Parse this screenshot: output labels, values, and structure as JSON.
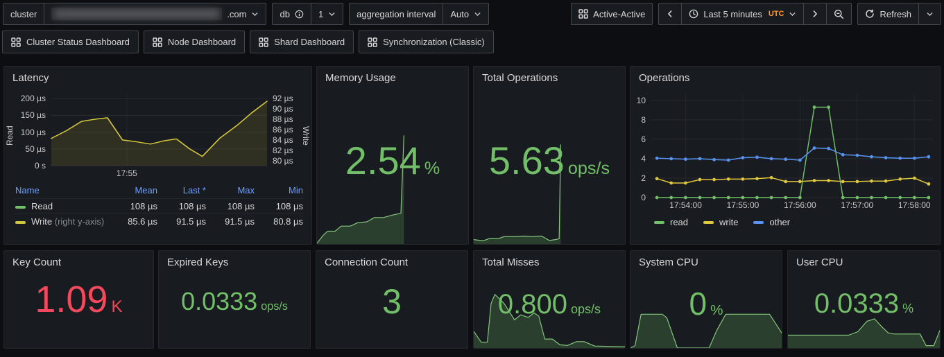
{
  "toolbar": {
    "cluster": {
      "label": "cluster",
      "value_suffix": ".com"
    },
    "db": {
      "label": "db",
      "value": "1"
    },
    "aggregation": {
      "label": "aggregation interval",
      "value": "Auto"
    },
    "active_active_label": "Active-Active",
    "time_range": {
      "label": "Last 5 minutes",
      "timezone": "UTC"
    },
    "refresh_label": "Refresh"
  },
  "nav": {
    "links": [
      {
        "label": "Cluster Status Dashboard"
      },
      {
        "label": "Node Dashboard"
      },
      {
        "label": "Shard Dashboard"
      },
      {
        "label": "Synchronization (Classic)"
      }
    ]
  },
  "colors": {
    "green": "#73BF69",
    "red": "#F2495C",
    "yellow": "#d4c63c",
    "blue": "#5794F2",
    "link_blue": "#6E9FFF",
    "utc_orange": "#FF9830"
  },
  "icons": {
    "apps_icon": "grid of four squares",
    "info_circle_icon": "i in circle",
    "clock_icon": "clock face",
    "zoom_out_icon": "magnifier with minus",
    "refresh_icon": "circular sync arrow",
    "chevron_down_icon": "v",
    "chevron_left_icon": "<",
    "chevron_right_icon": ">"
  },
  "panels": {
    "latency": {
      "title": "Latency",
      "legend": {
        "headers": [
          "Name",
          "Mean",
          "Last *",
          "Max",
          "Min"
        ],
        "rows": [
          {
            "name": "Read",
            "note": "",
            "color": "#73BF69",
            "mean": "108 µs",
            "last": "108 µs",
            "max": "108 µs",
            "min": "108 µs"
          },
          {
            "name": "Write",
            "note": "(right y-axis)",
            "color": "#d4c63c",
            "mean": "85.6 µs",
            "last": "91.5 µs",
            "max": "91.5 µs",
            "min": "80.8 µs"
          }
        ]
      }
    },
    "memory": {
      "title": "Memory Usage",
      "value": "2.54",
      "unit": "%"
    },
    "total_operations": {
      "title": "Total Operations",
      "value": "5.63",
      "unit": "ops/s"
    },
    "operations": {
      "title": "Operations",
      "legend": [
        {
          "label": "read",
          "color": "#73BF69"
        },
        {
          "label": "write",
          "color": "#e0c73e"
        },
        {
          "label": "other",
          "color": "#5794F2"
        }
      ]
    },
    "key_count": {
      "title": "Key Count",
      "value": "1.09",
      "unit": "K"
    },
    "expired_keys": {
      "title": "Expired Keys",
      "value": "0.0333",
      "unit": "ops/s"
    },
    "connection_count": {
      "title": "Connection Count",
      "value": "3",
      "unit": ""
    },
    "total_misses": {
      "title": "Total Misses",
      "value": "0.800",
      "unit": "ops/s"
    },
    "system_cpu": {
      "title": "System CPU",
      "value": "0",
      "unit": "%"
    },
    "user_cpu": {
      "title": "User CPU",
      "value": "0.0333",
      "unit": "%"
    }
  },
  "chart_data": [
    {
      "id": "latency",
      "type": "line",
      "vb": [
        270,
        104
      ],
      "axes": {
        "left": {
          "label": "Read",
          "ylim": [
            0,
            215
          ],
          "ticks": [
            {
              "v": 200,
              "label": "200 µs"
            },
            {
              "v": 150,
              "label": "150 µs"
            },
            {
              "v": 100,
              "label": "100 µs"
            },
            {
              "v": 50,
              "label": "50 µs"
            },
            {
              "v": 0,
              "label": "0 s"
            }
          ]
        },
        "right": {
          "label": "Write",
          "ylim": [
            79,
            93
          ],
          "ticks": [
            {
              "v": 92,
              "label": "92 µs"
            },
            {
              "v": 90,
              "label": "90 µs"
            },
            {
              "v": 88,
              "label": "88 µs"
            },
            {
              "v": 86,
              "label": "86 µs"
            },
            {
              "v": 84,
              "label": "84 µs"
            },
            {
              "v": 82,
              "label": "82 µs"
            },
            {
              "v": 80,
              "label": "80 µs"
            }
          ]
        }
      },
      "grid_y": [
        0,
        50,
        100,
        150,
        200
      ],
      "xticks": [
        {
          "frac": 0.35,
          "label": "17:55"
        }
      ],
      "series": [
        {
          "name": "Read",
          "axis": "left",
          "color": "#73BF69",
          "visible": false,
          "x": [
            0,
            1
          ],
          "values": [
            108,
            108
          ]
        },
        {
          "name": "Write",
          "axis": "right",
          "color": "#d4c63c",
          "fill": "rgba(212,198,60,0.12)",
          "width": 1.5,
          "x": [
            0,
            0.07,
            0.14,
            0.2,
            0.26,
            0.33,
            0.4,
            0.46,
            0.52,
            0.58,
            0.64,
            0.7,
            0.78,
            0.86,
            0.93,
            1.0
          ],
          "values": [
            84.3,
            85.8,
            87.6,
            88.0,
            88.3,
            84.0,
            83.6,
            83.2,
            83.8,
            84.2,
            82.3,
            80.8,
            84.3,
            86.8,
            89.3,
            91.5
          ]
        }
      ]
    },
    {
      "id": "operations",
      "type": "line",
      "vb": [
        415,
        150
      ],
      "axes": {
        "left": {
          "label": "",
          "ylim": [
            0,
            10.7
          ],
          "ticks": [
            {
              "v": 10,
              "label": "10"
            },
            {
              "v": 8,
              "label": "8"
            },
            {
              "v": 6,
              "label": "6"
            },
            {
              "v": 4,
              "label": "4"
            },
            {
              "v": 2,
              "label": "2"
            },
            {
              "v": 0,
              "label": "0"
            }
          ]
        }
      },
      "grid_y": [
        0,
        2,
        4,
        6,
        8,
        10
      ],
      "xticks": [
        {
          "frac": 0.122,
          "label": "17:54:00"
        },
        {
          "frac": 0.325,
          "label": "17:55:00"
        },
        {
          "frac": 0.528,
          "label": "17:56:00"
        },
        {
          "frac": 0.731,
          "label": "17:57:00"
        },
        {
          "frac": 0.934,
          "label": "17:58:00"
        }
      ],
      "series": [
        {
          "name": "read",
          "axis": "left",
          "color": "#73BF69",
          "points": true,
          "width": 1.5,
          "x": [
            0.02,
            0.0708,
            0.1216,
            0.1724,
            0.2232,
            0.274,
            0.3248,
            0.3756,
            0.4264,
            0.4772,
            0.528,
            0.5788,
            0.6296,
            0.6804,
            0.7312,
            0.782,
            0.8328,
            0.8836,
            0.9344,
            0.985
          ],
          "values": [
            0,
            0,
            0,
            0,
            0,
            0,
            0,
            0,
            0,
            0,
            0,
            9.3,
            9.3,
            0,
            0,
            0,
            0,
            0,
            0,
            0
          ]
        },
        {
          "name": "write",
          "axis": "left",
          "color": "#e0c73e",
          "points": true,
          "width": 1.5,
          "x": [
            0.02,
            0.0708,
            0.1216,
            0.1724,
            0.2232,
            0.274,
            0.3248,
            0.3756,
            0.4264,
            0.4772,
            0.528,
            0.5788,
            0.6296,
            0.6804,
            0.7312,
            0.782,
            0.8328,
            0.8836,
            0.9344,
            0.985
          ],
          "values": [
            1.95,
            1.5,
            1.5,
            1.85,
            1.85,
            1.9,
            1.9,
            1.95,
            2.05,
            1.65,
            1.65,
            1.75,
            1.75,
            1.65,
            1.65,
            1.7,
            1.7,
            1.9,
            2.0,
            1.4
          ]
        },
        {
          "name": "other",
          "axis": "left",
          "color": "#5794F2",
          "points": true,
          "width": 1.5,
          "x": [
            0.02,
            0.0708,
            0.1216,
            0.1724,
            0.2232,
            0.274,
            0.3248,
            0.3756,
            0.4264,
            0.4772,
            0.528,
            0.5788,
            0.6296,
            0.6804,
            0.7312,
            0.782,
            0.8328,
            0.8836,
            0.9344,
            0.985
          ],
          "values": [
            4.05,
            4.0,
            3.95,
            4.0,
            3.9,
            3.85,
            4.1,
            4.15,
            4.0,
            3.95,
            3.85,
            5.1,
            5.05,
            4.4,
            4.35,
            4.2,
            4.1,
            4.05,
            4.05,
            4.2
          ]
        }
      ]
    },
    {
      "id": "spark_memory",
      "type": "area",
      "vb": [
        220,
        160
      ],
      "ylim": [
        0,
        2.6
      ],
      "series": [
        {
          "color": "#86c77d",
          "width": 1.2,
          "fill": "rgba(115,191,105,0.22)",
          "x": [
            0,
            0.04,
            0.07,
            0.12,
            0.16,
            0.22,
            0.27,
            0.33,
            0.38,
            0.44,
            0.5,
            0.555,
            0.575
          ],
          "values": [
            0.02,
            0.2,
            0.3,
            0.3,
            0.42,
            0.42,
            0.5,
            0.52,
            0.62,
            0.62,
            0.68,
            0.72,
            2.54
          ]
        }
      ]
    },
    {
      "id": "spark_totalops",
      "type": "area",
      "vb": [
        220,
        150
      ],
      "ylim": [
        0,
        5.9
      ],
      "series": [
        {
          "color": "#86c77d",
          "width": 1.2,
          "fill": "rgba(115,191,105,0.22)",
          "x": [
            0,
            0.06,
            0.1,
            0.16,
            0.2,
            0.28,
            0.33,
            0.38,
            0.45,
            0.5,
            0.54,
            0.565,
            0.575
          ],
          "values": [
            0.25,
            0.18,
            0.3,
            0.3,
            0.42,
            0.42,
            0.45,
            0.42,
            0.45,
            0.2,
            0.25,
            0.3,
            5.63
          ]
        }
      ]
    },
    {
      "id": "spark_misses",
      "type": "area",
      "vb": [
        220,
        92
      ],
      "ylim": [
        0,
        1
      ],
      "series": [
        {
          "color": "#86c77d",
          "width": 1.2,
          "fill": "rgba(115,191,105,0.22)",
          "x": [
            0,
            0.05,
            0.09,
            0.115,
            0.14,
            0.2,
            0.27,
            0.31,
            0.36,
            0.4,
            0.43,
            0.47,
            0.52,
            0.57,
            0.62,
            0.68,
            0.73,
            0.8,
            1.0
          ],
          "values": [
            0.26,
            0.09,
            0.09,
            0.7,
            0.84,
            0.7,
            0.44,
            0.52,
            0.48,
            0.55,
            0.5,
            0.14,
            0.14,
            0.05,
            0.04,
            0.1,
            0.1,
            0.03,
            0.02
          ]
        }
      ]
    },
    {
      "id": "spark_syscpu",
      "type": "area",
      "vb": [
        220,
        84
      ],
      "ylim": [
        0,
        1
      ],
      "series": [
        {
          "color": "#86c77d",
          "width": 1.2,
          "fill": "rgba(115,191,105,0.22)",
          "x": [
            0,
            0.03,
            0.07,
            0.21,
            0.24,
            0.31,
            0.52,
            0.57,
            0.63,
            0.92,
            1.0
          ],
          "values": [
            0,
            0.04,
            0.58,
            0.58,
            0.52,
            0,
            0,
            0.3,
            0.58,
            0.58,
            0.26
          ]
        }
      ]
    },
    {
      "id": "spark_usercpu",
      "type": "area",
      "vb": [
        221,
        84
      ],
      "ylim": [
        0,
        1
      ],
      "series": [
        {
          "color": "#86c77d",
          "width": 1.2,
          "fill": "rgba(115,191,105,0.22)",
          "x": [
            0,
            0.4,
            0.46,
            0.52,
            0.57,
            0.62,
            0.66,
            0.7,
            0.87,
            0.91,
            0.96,
            1.0
          ],
          "values": [
            0.22,
            0.22,
            0.28,
            0.46,
            0.5,
            0.36,
            0.26,
            0.24,
            0.24,
            0.04,
            0.04,
            0.3
          ]
        }
      ]
    }
  ]
}
